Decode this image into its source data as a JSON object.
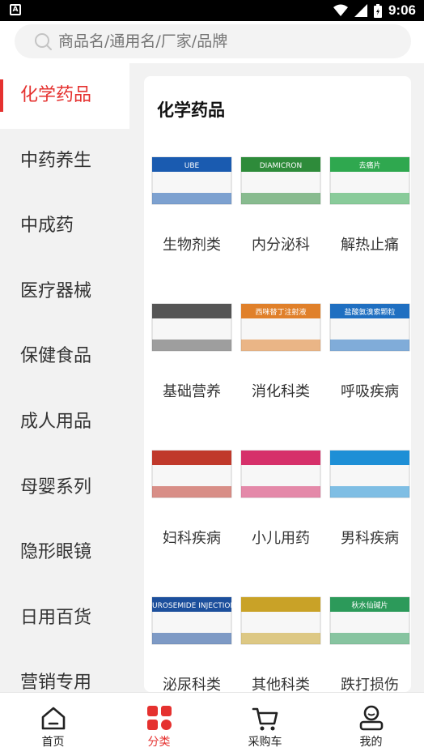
{
  "status_bar": {
    "time": "9:06",
    "left_badge": "A"
  },
  "search": {
    "placeholder": "商品名/通用名/厂家/品牌"
  },
  "sidebar": {
    "items": [
      {
        "label": "化学药品",
        "active": true
      },
      {
        "label": "中药养生"
      },
      {
        "label": "中成药"
      },
      {
        "label": "医疗器械"
      },
      {
        "label": "保健食品"
      },
      {
        "label": "成人用品"
      },
      {
        "label": "母婴系列"
      },
      {
        "label": "隐形眼镜"
      },
      {
        "label": "日用百货"
      },
      {
        "label": "营销专用"
      }
    ]
  },
  "content": {
    "title": "化学药品",
    "categories": [
      {
        "label": "生物剂类",
        "box": "UBE",
        "accent": "#1a5bb0"
      },
      {
        "label": "内分泌科",
        "box": "DIAMICRON",
        "accent": "#2e8b3a"
      },
      {
        "label": "解热止痛",
        "box": "去痛片",
        "accent": "#2fa84f"
      },
      {
        "label": "基础营养",
        "box": "",
        "accent": "#555555"
      },
      {
        "label": "消化科类",
        "box": "西咪替丁注射液",
        "accent": "#e0802a"
      },
      {
        "label": "呼吸疾病",
        "box": "盐酸氨溴索颗粒",
        "accent": "#1f6fc1"
      },
      {
        "label": "妇科疾病",
        "box": "",
        "accent": "#c0392b"
      },
      {
        "label": "小儿用药",
        "box": "",
        "accent": "#d6306a"
      },
      {
        "label": "男科疾病",
        "box": "",
        "accent": "#1e8fd6"
      },
      {
        "label": "泌尿科类",
        "box": "FUROSEMIDE INJECTION",
        "accent": "#1c4f9c"
      },
      {
        "label": "其他科类",
        "box": "",
        "accent": "#c9a227"
      },
      {
        "label": "跌打损伤",
        "box": "秋水仙碱片",
        "accent": "#2c9a5a"
      }
    ]
  },
  "bottom_nav": {
    "items": [
      {
        "label": "首页",
        "icon": "home-icon"
      },
      {
        "label": "分类",
        "icon": "category-icon",
        "active": true
      },
      {
        "label": "采购车",
        "icon": "cart-icon"
      },
      {
        "label": "我的",
        "icon": "profile-icon"
      }
    ]
  },
  "colors": {
    "accent": "#e5312f"
  }
}
